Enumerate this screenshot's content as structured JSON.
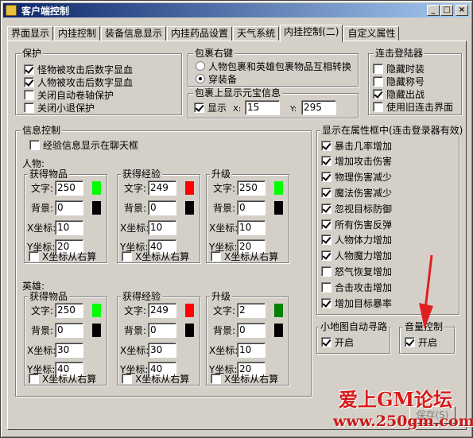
{
  "window": {
    "title": "客户端控制",
    "min": "_",
    "max": "□",
    "close": "×"
  },
  "tabs": [
    "界面显示",
    "内挂控制",
    "装备信息显示",
    "内挂药品设置",
    "天气系统",
    "内挂控制(二)",
    "自定义属性"
  ],
  "protect": {
    "title": "保护",
    "items": [
      {
        "label": "怪物被攻击后数字显血",
        "checked": true
      },
      {
        "label": "人物被攻击后数字显血",
        "checked": true
      },
      {
        "label": "关闭自动卷轴保护",
        "checked": false
      },
      {
        "label": "关闭小退保护",
        "checked": false
      }
    ]
  },
  "bag_right": {
    "title": "包裹右键",
    "options": [
      {
        "label": "人物包裹和英雄包裹物品互相转换",
        "selected": false
      },
      {
        "label": "穿装备",
        "selected": true
      }
    ]
  },
  "bag_yuanbao": {
    "title": "包裹上显示元宝信息",
    "show_label": "显示",
    "show_checked": true,
    "x_label": "X:",
    "x_value": "15",
    "y_label": "Y:",
    "y_value": "295"
  },
  "login": {
    "title": "连击登陆器",
    "items": [
      {
        "label": "隐藏时装",
        "checked": false
      },
      {
        "label": "隐藏称号",
        "checked": false
      },
      {
        "label": "隐藏出战",
        "checked": true
      },
      {
        "label": "使用旧连击界面",
        "checked": false
      }
    ]
  },
  "info": {
    "title": "信息控制",
    "exp_chat": {
      "label": "经验信息显示在聊天框",
      "checked": false
    },
    "labels": {
      "text": "文字:",
      "bg": "背景:",
      "x": "X坐标:",
      "y": "Y坐标:",
      "xright": "X坐标从右算"
    },
    "sections": [
      {
        "title": "人物:",
        "groups": [
          {
            "title": "获得物品",
            "text": "250",
            "bg": "0",
            "x": "10",
            "y": "20",
            "text_color": "#00ff00",
            "bg_color": "#000000",
            "xright": false
          },
          {
            "title": "获得经验",
            "text": "249",
            "bg": "0",
            "x": "10",
            "y": "40",
            "text_color": "#ff0000",
            "bg_color": "#000000",
            "xright": false
          },
          {
            "title": "升级",
            "text": "250",
            "bg": "0",
            "x": "10",
            "y": "20",
            "text_color": "#00ff00",
            "bg_color": "#000000",
            "xright": false
          }
        ]
      },
      {
        "title": "英雄:",
        "groups": [
          {
            "title": "获得物品",
            "text": "250",
            "bg": "0",
            "x": "30",
            "y": "40",
            "text_color": "#00ff00",
            "bg_color": "#000000",
            "xright": false
          },
          {
            "title": "获得经验",
            "text": "249",
            "bg": "0",
            "x": "30",
            "y": "40",
            "text_color": "#ff0000",
            "bg_color": "#000000",
            "xright": false
          },
          {
            "title": "升级",
            "text": "2",
            "bg": "0",
            "x": "10",
            "y": "20",
            "text_color": "#008000",
            "bg_color": "#000000",
            "xright": false
          }
        ]
      }
    ]
  },
  "attr_box": {
    "title": "显示在属性框中(连击登录器有效)",
    "items": [
      {
        "label": "暴击几率增加",
        "checked": true
      },
      {
        "label": "增加攻击伤害",
        "checked": true
      },
      {
        "label": "物理伤害减少",
        "checked": true
      },
      {
        "label": "魔法伤害减少",
        "checked": true
      },
      {
        "label": "忽视目标防御",
        "checked": true
      },
      {
        "label": "所有伤害反弹",
        "checked": true
      },
      {
        "label": "人物体力增加",
        "checked": true
      },
      {
        "label": "人物魔力增加",
        "checked": true
      },
      {
        "label": "怒气恢复增加",
        "checked": false
      },
      {
        "label": "合击攻击增加",
        "checked": false
      },
      {
        "label": "增加目标暴率",
        "checked": true
      }
    ]
  },
  "minimap": {
    "title": "小地图自动寻路",
    "label": "开启",
    "checked": true
  },
  "volume": {
    "title": "音量控制",
    "label": "开启",
    "checked": true
  },
  "save_button": "保存(S)",
  "watermark": {
    "line1": "爱上GM论坛",
    "line2": "www.250gm.com"
  }
}
